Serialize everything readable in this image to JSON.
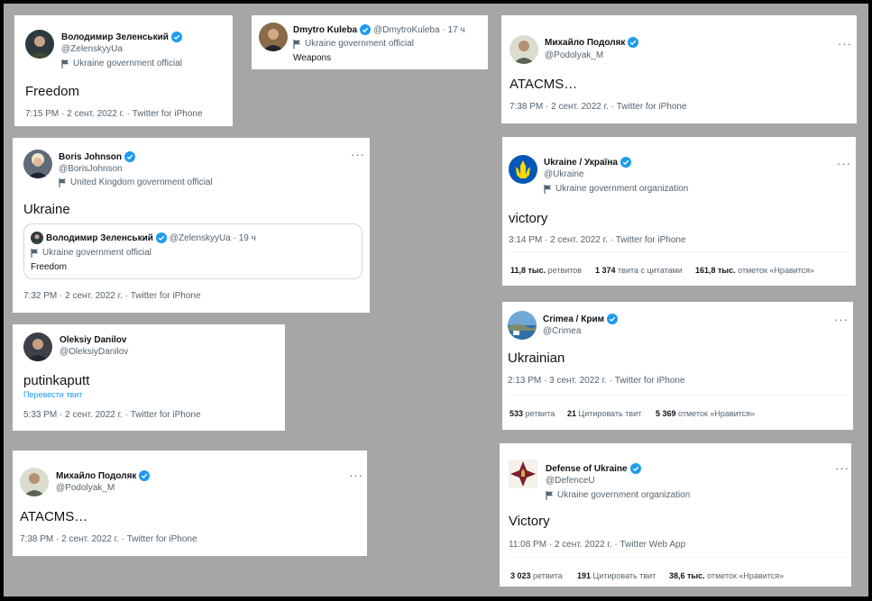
{
  "tweets": {
    "zelensky": {
      "name": "Володимир Зеленський",
      "handle": "@ZelenskyyUa",
      "label": "Ukraine government official",
      "text": "Freedom",
      "meta": "7:15 PM · 2 сент. 2022 г. · Twitter for iPhone"
    },
    "kuleba": {
      "name": "Dmytro Kuleba",
      "handle_time": "@DmytroKuleba · 17 ч",
      "label": "Ukraine government official",
      "text": "Weapons"
    },
    "podolyak_top": {
      "name": "Михайло Подоляк",
      "handle": "@Podolyak_M",
      "text": "ATACMS…",
      "meta": "7:38 PM · 2 сент. 2022 г. · Twitter for iPhone"
    },
    "johnson": {
      "name": "Boris Johnson",
      "handle": "@BorisJohnson",
      "label": "United Kingdom government official",
      "text": "Ukraine",
      "meta": "7:32 PM · 2 сент. 2022 г. · Twitter for iPhone",
      "quote": {
        "name": "Володимир Зеленський",
        "handle_time": "@ZelenskyyUa · 19 ч",
        "label": "Ukraine government official",
        "text": "Freedom"
      }
    },
    "ukraine": {
      "name": "Ukraine / Україна",
      "handle": "@Ukraine",
      "label": "Ukraine government organization",
      "text": "victory",
      "meta": "3:14 PM · 2 сент. 2022 г. · Twitter for iPhone",
      "retweets_num": "11,8 тыс.",
      "retweets_label": "ретвитов",
      "quotes_num": "1 374",
      "quotes_label": "твита с цитатами",
      "likes_num": "161,8 тыс.",
      "likes_label": "отметок «Нравится»"
    },
    "danilov": {
      "name": "Oleksiy Danilov",
      "handle": "@OleksiyDanilov",
      "text": "putinkaputt",
      "translate": "Перевести твит",
      "meta": "5:33 PM · 2 сент. 2022 г. · Twitter for iPhone"
    },
    "crimea": {
      "name": "Crimea / Крим",
      "handle": "@Crimea",
      "text": "Ukrainian",
      "meta": "2:13 PM · 3 сент. 2022 г. · Twitter for iPhone",
      "retweets_num": "533",
      "retweets_label": "ретвита",
      "quotes_num": "21",
      "quotes_label": "Цитировать твит",
      "likes_num": "5 369",
      "likes_label": "отметок «Нравится»"
    },
    "podolyak_bottom": {
      "name": "Михайло Подоляк",
      "handle": "@Podolyak_M",
      "text": "ATACMS…",
      "meta": "7:38 PM · 2 сент. 2022 г. · Twitter for iPhone"
    },
    "defence": {
      "name": "Defense of Ukraine",
      "handle": "@DefenceU",
      "label": "Ukraine government organization",
      "text": "Victory",
      "meta": "11:08 PM · 2 сент. 2022 г. · Twitter Web App",
      "retweets_num": "3 023",
      "retweets_label": "ретвита",
      "quotes_num": "191",
      "quotes_label": "Цитировать твит",
      "likes_num": "38,6 тыс.",
      "likes_label": "отметок «Нравится»"
    }
  },
  "more_glyph": "···",
  "colors": {
    "verified": "#1d9bf0",
    "muted": "#536471",
    "background": "#a6a6a6"
  }
}
